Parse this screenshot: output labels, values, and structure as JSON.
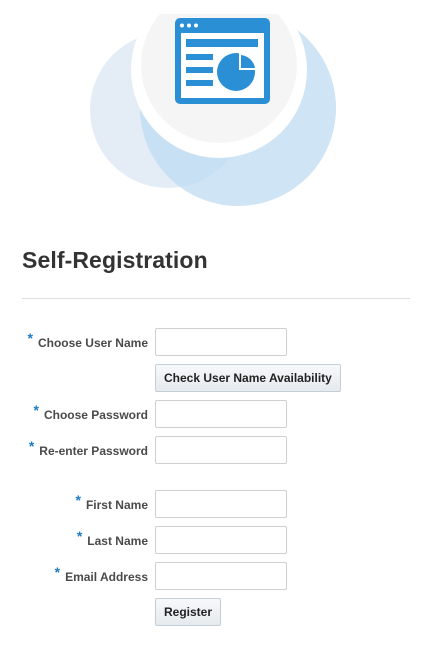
{
  "page": {
    "title": "Self-Registration"
  },
  "form": {
    "required_marker": "*",
    "fields": {
      "username": {
        "label": "Choose User Name",
        "value": ""
      },
      "password": {
        "label": "Choose Password",
        "value": ""
      },
      "reenter_password": {
        "label": "Re-enter Password",
        "value": ""
      },
      "first_name": {
        "label": "First Name",
        "value": ""
      },
      "last_name": {
        "label": "Last Name",
        "value": ""
      },
      "email": {
        "label": "Email Address",
        "value": ""
      }
    },
    "check_availability_label": "Check User Name Availability",
    "register_label": "Register"
  },
  "hero": {
    "icon": "dashboard-report-icon",
    "accent_color": "#2b8fd6",
    "bubble_light": "#dde8f3",
    "bubble_blue": "#cde3f4"
  }
}
